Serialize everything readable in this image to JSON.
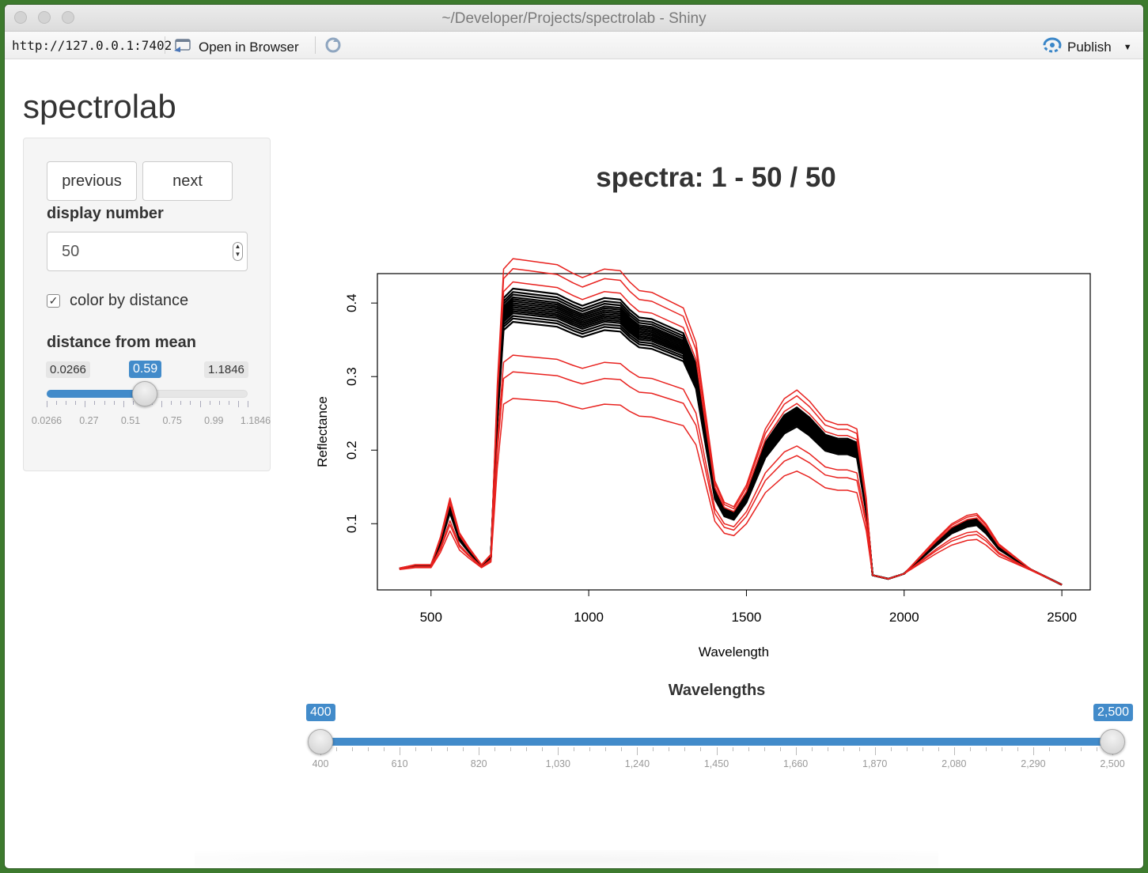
{
  "window": {
    "title": "~/Developer/Projects/spectrolab - Shiny",
    "url": "http://127.0.0.1:7402",
    "open_in_browser": "Open in Browser",
    "publish": "Publish"
  },
  "app": {
    "title": "spectrolab",
    "previous_label": "previous",
    "next_label": "next",
    "display_number_label": "display number",
    "display_number_value": "50",
    "color_by_distance_label": "color by distance",
    "color_by_distance_checked": true,
    "distance_label": "distance from mean",
    "distance_slider": {
      "min_label": "0.0266",
      "max_label": "1.1846",
      "value_label": "0.59",
      "min": 0.0266,
      "max": 1.1846,
      "value": 0.59,
      "ticks": [
        "0.0266",
        "0.27",
        "0.51",
        "0.75",
        "0.99",
        "1.1846"
      ]
    },
    "wavelengths_label": "Wavelengths",
    "wavelength_slider": {
      "from_label": "400",
      "to_label": "2,500",
      "min": 400,
      "max": 2500,
      "from": 400,
      "to": 2500,
      "ticks": [
        "400",
        "610",
        "820",
        "1,030",
        "1,240",
        "1,450",
        "1,660",
        "1,870",
        "2,080",
        "2,290",
        "2,500"
      ]
    }
  },
  "chart_data": {
    "type": "line",
    "title": "spectra: 1 - 50 / 50",
    "xlabel": "Wavelength",
    "ylabel": "Reflectance",
    "xlim": [
      330,
      2590
    ],
    "ylim": [
      0.01,
      0.44
    ],
    "x_ticks": [
      500,
      1000,
      1500,
      2000,
      2500
    ],
    "y_ticks": [
      0.1,
      0.2,
      0.3,
      0.4
    ],
    "grid": false,
    "colors": {
      "typical": "#000000",
      "distant": "#e8221f"
    },
    "x": [
      400,
      450,
      500,
      530,
      560,
      590,
      620,
      660,
      690,
      710,
      730,
      760,
      800,
      900,
      950,
      980,
      1050,
      1100,
      1130,
      1160,
      1200,
      1300,
      1340,
      1370,
      1400,
      1430,
      1460,
      1500,
      1560,
      1620,
      1660,
      1700,
      1750,
      1790,
      1820,
      1850,
      1880,
      1900,
      1950,
      2000,
      2100,
      2150,
      2200,
      2230,
      2260,
      2300,
      2400,
      2500
    ],
    "mean_spectrum": [
      0.039,
      0.043,
      0.043,
      0.075,
      0.12,
      0.08,
      0.063,
      0.043,
      0.055,
      0.25,
      0.385,
      0.397,
      0.395,
      0.39,
      0.38,
      0.375,
      0.385,
      0.383,
      0.37,
      0.36,
      0.358,
      0.34,
      0.3,
      0.22,
      0.14,
      0.115,
      0.11,
      0.135,
      0.2,
      0.235,
      0.245,
      0.232,
      0.21,
      0.205,
      0.205,
      0.2,
      0.12,
      0.03,
      0.025,
      0.032,
      0.072,
      0.09,
      0.1,
      0.102,
      0.09,
      0.067,
      0.038,
      0.017
    ],
    "series": [
      {
        "color": "black",
        "count": 44,
        "offsets": [
          -0.025,
          -0.02,
          -0.016,
          -0.012,
          -0.009,
          -0.006,
          -0.003,
          0,
          0.003,
          0.006,
          0.009,
          0.012,
          0.016,
          0.02,
          0.025
        ]
      },
      {
        "color": "red",
        "count": 6,
        "offsets": [
          -0.14,
          -0.1,
          -0.075,
          0.035,
          0.055,
          0.07
        ]
      }
    ]
  }
}
